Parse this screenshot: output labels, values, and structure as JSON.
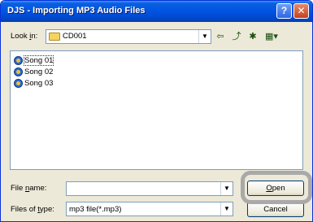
{
  "window": {
    "title": "DJS - Importing MP3 Audio Files",
    "help": "?",
    "close": "✕"
  },
  "lookin": {
    "label_pre": "Look ",
    "label_key": "i",
    "label_post": "n:",
    "value": "CD001"
  },
  "toolbar": {
    "back": "⇦",
    "up": "⤴",
    "new_folder": "✱",
    "view": "▦▾"
  },
  "files": [
    {
      "name": "Song 01",
      "selected": true
    },
    {
      "name": "Song 02",
      "selected": false
    },
    {
      "name": "Song 03",
      "selected": false
    }
  ],
  "filename": {
    "label_pre": "File ",
    "label_key": "n",
    "label_post": "ame:",
    "value": ""
  },
  "filetype": {
    "label_pre": "Files of ",
    "label_key": "t",
    "label_post": "ype:",
    "value": "mp3 file(*.mp3)"
  },
  "buttons": {
    "open_key": "O",
    "open_rest": "pen",
    "cancel": "Cancel"
  },
  "dropdown_arrow": "▼"
}
